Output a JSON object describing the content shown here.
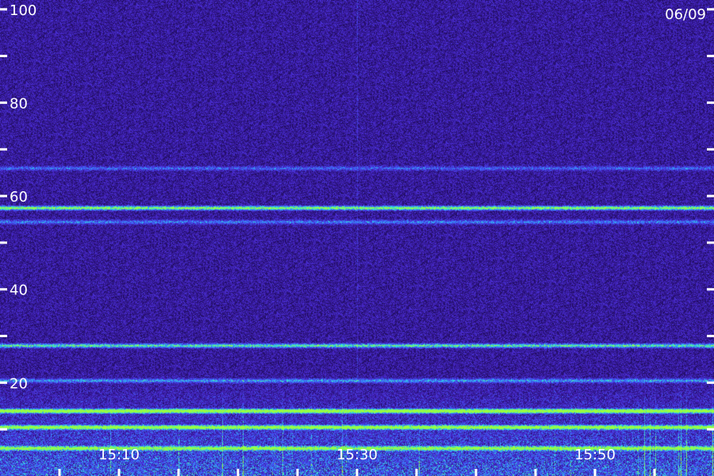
{
  "chart_data": {
    "type": "heatmap",
    "date_label": "06/09",
    "y_tick_labels": [
      "20",
      "40",
      "60",
      "80",
      "100"
    ],
    "y_ticks": [
      10,
      20,
      30,
      40,
      50,
      60,
      70,
      80,
      90,
      100
    ],
    "ylim": [
      0,
      102
    ],
    "x_tick_labels": [
      "15:10",
      "15:30",
      "15:50"
    ],
    "x_tick_minutes": [
      5,
      10,
      15,
      20,
      25,
      30,
      35,
      40,
      45,
      50,
      55
    ],
    "xlim_minutes": [
      0,
      60
    ],
    "colors": {
      "background": "#2a1178",
      "noise_high": "#4a2ad0",
      "signal_mid": "#3b6cff",
      "signal_strong": "#2ee0e0",
      "signal_peak": "#9aff40"
    },
    "bands": [
      {
        "center": 57.5,
        "strength": 0.75
      },
      {
        "center": 54.5,
        "strength": 0.35
      },
      {
        "center": 66.0,
        "strength": 0.3
      },
      {
        "center": 28.0,
        "strength": 0.6
      },
      {
        "center": 20.5,
        "strength": 0.4
      },
      {
        "center": 14.0,
        "strength": 0.9
      },
      {
        "center": 10.5,
        "strength": 0.8
      },
      {
        "center": 6.0,
        "strength": 0.7
      }
    ]
  }
}
